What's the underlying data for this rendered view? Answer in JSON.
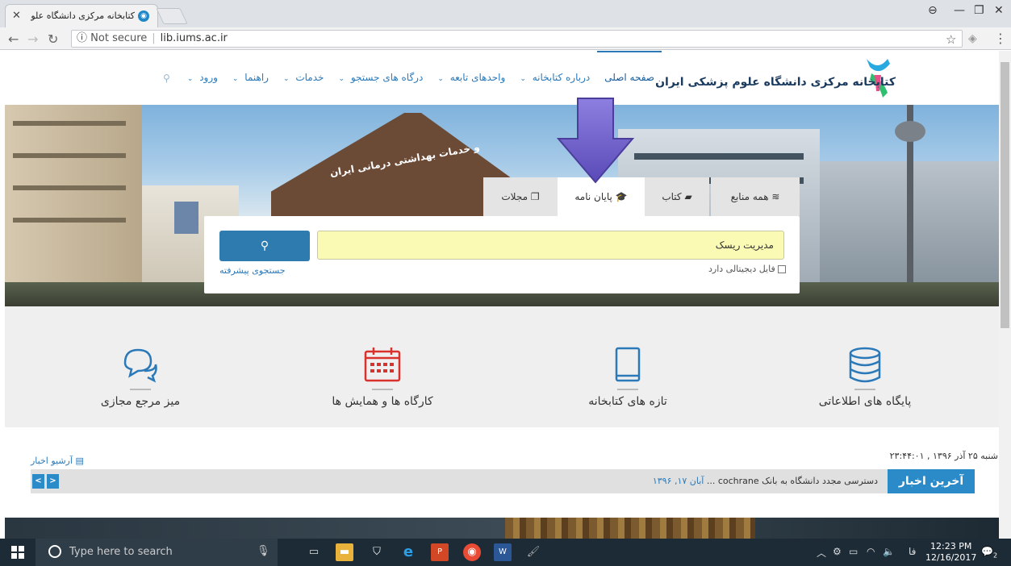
{
  "browser": {
    "tab_title": "کتابخانه مرکزی دانشگاه علو",
    "tab_favicon": "library-favicon",
    "security": "Not secure",
    "url": "lib.iums.ac.ir"
  },
  "site": {
    "logo_text": "کتابخانه مرکزی دانشگاه علوم پزشکی ایران",
    "nav": [
      {
        "label": "صفحه اصلی",
        "active": true
      },
      {
        "label": "درباره کتابخانه"
      },
      {
        "label": "واحدهای تابعه"
      },
      {
        "label": "درگاه های جستجو"
      },
      {
        "label": "خدمات"
      },
      {
        "label": "راهنما"
      },
      {
        "label": "ورود"
      }
    ],
    "hero_sign_text": "و خدمات بهداشتی درمانی ایران"
  },
  "search": {
    "tabs": [
      "همه منابع",
      "کتاب",
      "پایان نامه",
      "مجلات"
    ],
    "active_tab": "پایان نامه",
    "query": "مدیریت ریسک",
    "digital_file_label": "فایل دیجیتالی دارد",
    "advanced_link": "جستجوی پیشرفته"
  },
  "quick_links": [
    {
      "label": "پایگاه های اطلاعاتی",
      "icon": "database-icon"
    },
    {
      "label": "تازه های کتابخانه",
      "icon": "book-icon"
    },
    {
      "label": "کارگاه ها و همایش ها",
      "icon": "calendar-icon"
    },
    {
      "label": "میز مرجع مجازی",
      "icon": "chat-bubbles-icon"
    }
  ],
  "news": {
    "date": "شنبه ۲۵ آذر ۱۳۹۶ , ۲۳:۴۴:۰۱",
    "archive_label": "آرشیو اخبار",
    "label": "آخرین اخبار",
    "headline": "دسترسی مجدد دانشگاه به بانک cochrane ...",
    "headline_date": "آبان ۱۷, ۱۳۹۶"
  },
  "taskbar": {
    "search_placeholder": "Type here to search",
    "time": "12:23 PM",
    "date": "12/16/2017",
    "lang": "فا",
    "notification_count": "2"
  },
  "colors": {
    "brand_blue": "#2b79b8",
    "news_blue": "#2b8bc9",
    "search_yellow": "#fafab5",
    "quick_link_red": "#d9312b"
  }
}
